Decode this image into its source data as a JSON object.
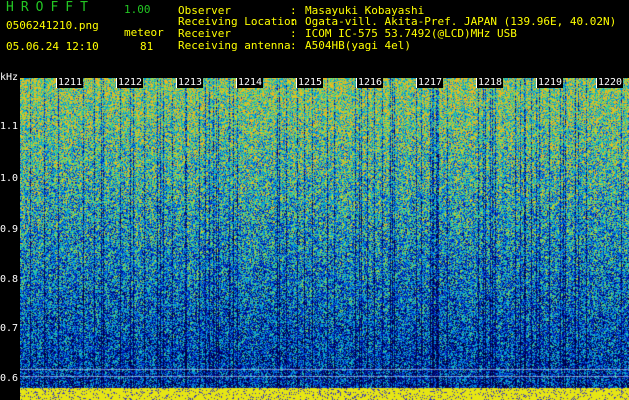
{
  "header": {
    "app_name": "HROFFT",
    "version": "1.00",
    "filename": "0506241210.png",
    "datetime": "05.06.24 12:10",
    "mode": "meteor",
    "count": "81"
  },
  "info": [
    {
      "label": "Observer",
      "value": "Masayuki Kobayashi"
    },
    {
      "label": "Receiving Location",
      "value": "Ogata-vill. Akita-Pref. JAPAN (139.96E, 40.02N)"
    },
    {
      "label": "Receiver",
      "value": "ICOM IC-575 53.7492(@LCD)MHz USB"
    },
    {
      "label": "Receiving antenna",
      "value": "A504HB(yagi 4el)"
    }
  ],
  "axis": {
    "unit": "kHz",
    "y_labels": [
      "1.1",
      "1.0",
      "0.9",
      "0.8",
      "0.7",
      "0.6"
    ],
    "x_labels": [
      "1211",
      "1212",
      "1213",
      "1214",
      "1215",
      "1216",
      "1217",
      "1218",
      "1219",
      "1220"
    ]
  },
  "colors": {
    "title_green": "#23c623",
    "text_yellow": "#ffff00",
    "text_white": "#ffffff"
  }
}
